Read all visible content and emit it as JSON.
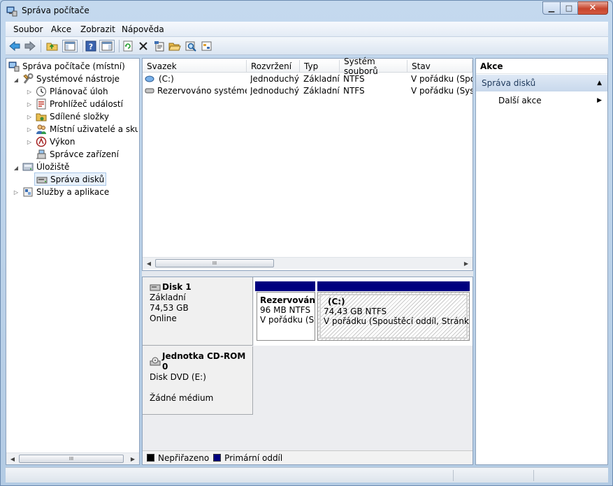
{
  "window": {
    "title": "Správa počítače"
  },
  "menu": [
    "Soubor",
    "Akce",
    "Zobrazit",
    "Nápověda"
  ],
  "toolbar": {
    "icons": [
      "back-arrow-icon",
      "forward-arrow-icon",
      "up-folder-icon",
      "show-hide-tree-icon",
      "help-icon",
      "show-hide-action-pane-icon",
      "refresh-icon",
      "delete-icon",
      "properties-icon",
      "open-folder-icon",
      "search-disk-icon",
      "settings-icon"
    ]
  },
  "tree": {
    "root": "Správa počítače (místní)",
    "system_tools": "Systémové nástroje",
    "task_scheduler": "Plánovač úloh",
    "event_viewer": "Prohlížeč událostí",
    "shared_folders": "Sdílené složky",
    "local_users": "Místní uživatelé a skupiny",
    "performance": "Výkon",
    "device_manager": "Správce zařízení",
    "storage": "Úložiště",
    "disk_management": "Správa disků",
    "services": "Služby a aplikace"
  },
  "volumes": {
    "columns": [
      "Svazek",
      "Rozvržení",
      "Typ",
      "Systém souborů",
      "Stav"
    ],
    "rows": [
      {
        "name": "(C:)",
        "layout": "Jednoduchý",
        "type": "Základní",
        "fs": "NTFS",
        "status": "V pořádku (Spouštěcí oddíl"
      },
      {
        "name": "Rezervováno systémem",
        "layout": "Jednoduchý",
        "type": "Základní",
        "fs": "NTFS",
        "status": "V pořádku (Systém"
      }
    ]
  },
  "disks": [
    {
      "name": "Disk 1",
      "type": "Základní",
      "size": "74,53 GB",
      "state": "Online",
      "partitions": [
        {
          "name": "Rezervováno systémem",
          "size": "96 MB NTFS",
          "status": "V pořádku (Systém"
        },
        {
          "name": "(C:)",
          "size": "74,43 GB NTFS",
          "status": "V pořádku (Spouštěcí oddíl, Stránkovací soubor"
        }
      ]
    },
    {
      "name": "Jednotka CD-ROM 0",
      "type": "Disk DVD (E:)",
      "state": "Žádné médium"
    }
  ],
  "legend": {
    "unallocated": "Nepřiřazeno",
    "primary": "Primární oddíl",
    "unallocated_color": "#000000",
    "primary_color": "#00007f"
  },
  "actions": {
    "header": "Akce",
    "group": "Správa disků",
    "more": "Další akce"
  },
  "scroll": {
    "grip": "III"
  }
}
